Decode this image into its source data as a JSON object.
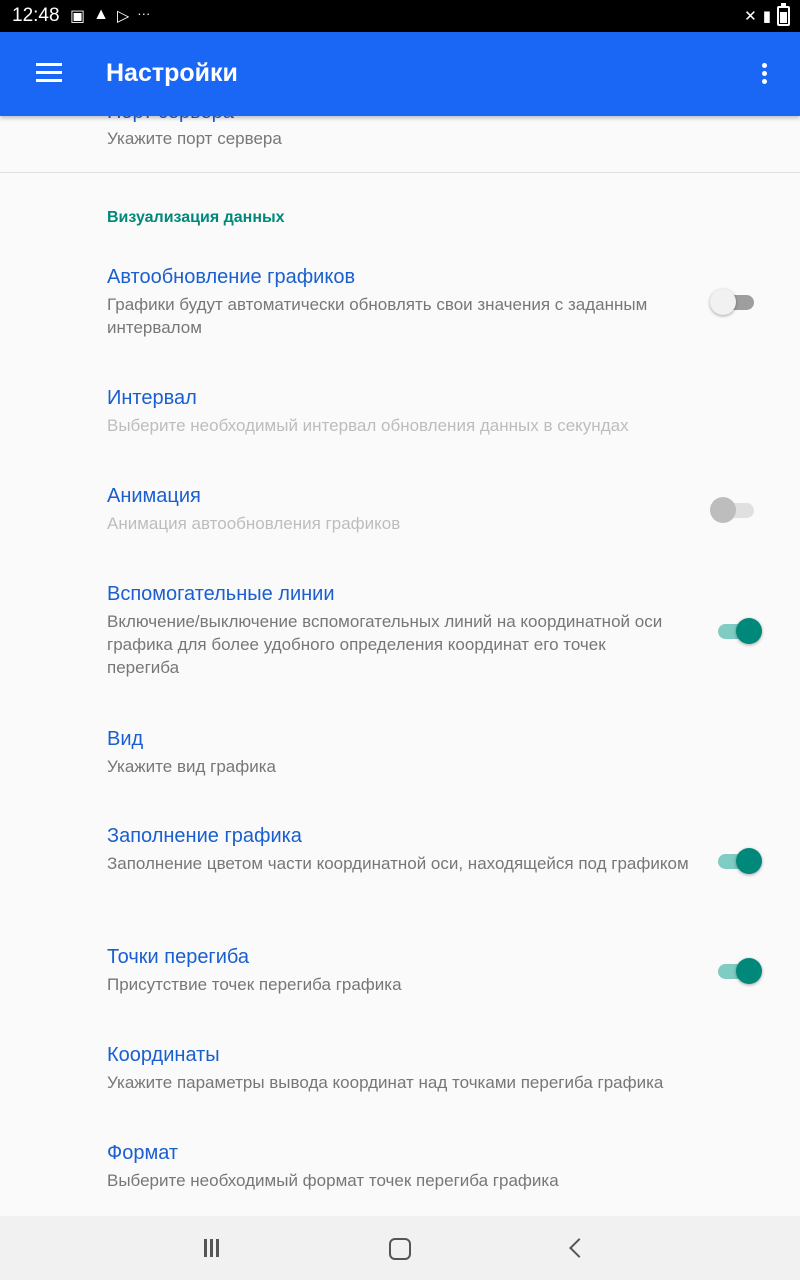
{
  "status_bar": {
    "time": "12:48",
    "left_icons": [
      "image-icon",
      "warning-icon",
      "play-store-icon",
      "more-dots-icon"
    ],
    "right_icons": [
      "mute-icon",
      "signal-icon",
      "battery-icon"
    ]
  },
  "app_bar": {
    "title": "Настройки",
    "background": "#1a66f5"
  },
  "partial_pref": {
    "title": "Порт сервера",
    "summary": "Укажите порт сервера"
  },
  "category": {
    "title": "Визуализация данных",
    "color": "#00897b"
  },
  "prefs": [
    {
      "title": "Автообновление графиков",
      "summary": "Графики будут автоматически обновлять свои значения с заданным интервалом",
      "switch": "off"
    },
    {
      "title": "Интервал",
      "summary": "Выберите необходимый интервал обновления данных в секундах",
      "enabled": false
    },
    {
      "title": "Анимация",
      "summary": "Анимация автообновления графиков",
      "switch": "off",
      "enabled": false
    },
    {
      "title": "Вспомогательные линии",
      "summary": "Включение/выключение вспомогательных линий на координатной оси графика для более удобного определения координат его точек перегиба",
      "switch": "on"
    },
    {
      "title": "Вид",
      "summary": "Укажите вид графика"
    },
    {
      "title": "Заполнение графика",
      "summary": "Заполнение цветом части координатной оси, находящейся под графиком",
      "switch": "on"
    },
    {
      "title": "Точки перегиба",
      "summary": "Присутствие точек перегиба графика",
      "switch": "on"
    },
    {
      "title": "Координаты",
      "summary": "Укажите параметры вывода координат над точками перегиба графика"
    },
    {
      "title": "Формат",
      "summary": "Выберите необходимый формат точек перегиба графика"
    }
  ],
  "colors": {
    "title_blue": "#1a5fcf",
    "accent_teal": "#00897b"
  }
}
